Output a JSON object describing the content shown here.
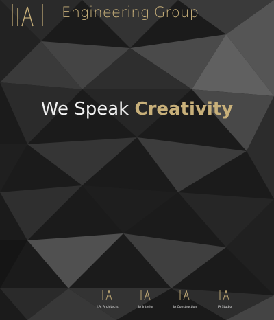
{
  "colors": {
    "gold": "#c8b07a",
    "white": "#f2f2f2",
    "background": "#1c1c1c",
    "facet_light": "#5a5a5a",
    "facet_dark": "#151515"
  },
  "header": {
    "logo_icon": "ia-monogram-icon",
    "brand_name": "Engineering Group"
  },
  "hero": {
    "tagline_light": "We Speak",
    "tagline_bold": "Creativity"
  },
  "divisions": [
    {
      "icon": "ia-monogram-icon",
      "label": "I.A. Architects"
    },
    {
      "icon": "ia-monogram-icon",
      "label": "IA Interior"
    },
    {
      "icon": "ia-monogram-icon",
      "label": "IA Construction"
    },
    {
      "icon": "ia-monogram-icon",
      "label": "IA Studio"
    }
  ]
}
